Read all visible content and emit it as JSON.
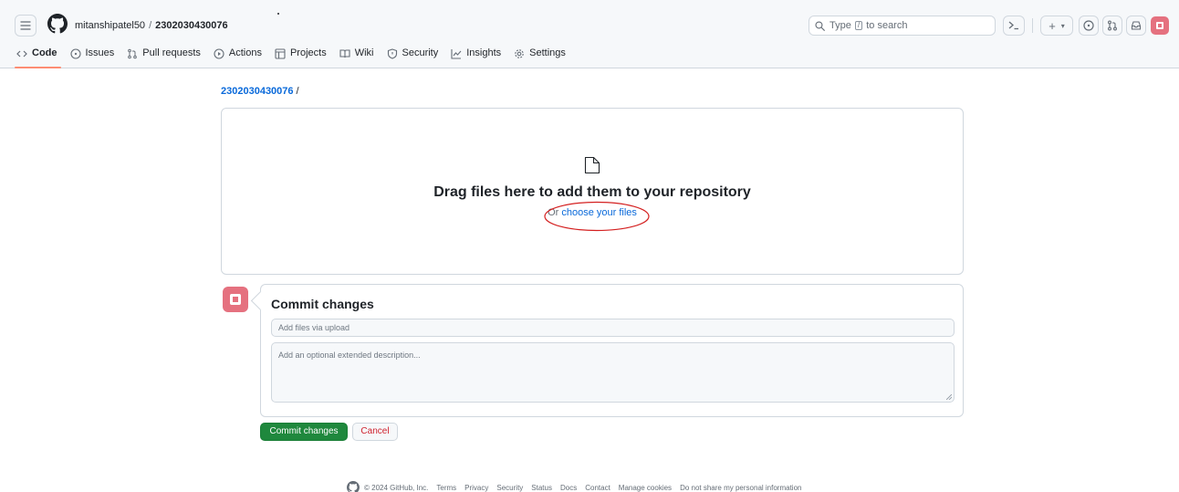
{
  "header": {
    "owner": "mitanshipatel50",
    "separator": "/",
    "repo": "2302030430076",
    "search": {
      "prefix": "Type",
      "key": "/",
      "suffix": "to search"
    },
    "create_label": "+",
    "create_caret": "▾"
  },
  "tabs": [
    {
      "label": "Code",
      "icon": "code-icon"
    },
    {
      "label": "Issues",
      "icon": "issue-icon"
    },
    {
      "label": "Pull requests",
      "icon": "pull-request-icon"
    },
    {
      "label": "Actions",
      "icon": "play-icon"
    },
    {
      "label": "Projects",
      "icon": "table-icon"
    },
    {
      "label": "Wiki",
      "icon": "book-icon"
    },
    {
      "label": "Security",
      "icon": "shield-icon"
    },
    {
      "label": "Insights",
      "icon": "graph-icon"
    },
    {
      "label": "Settings",
      "icon": "gear-icon"
    }
  ],
  "breadcrumb": {
    "repo": "2302030430076",
    "separator": "/"
  },
  "dropzone": {
    "title": "Drag files here to add them to your repository",
    "or_text": "Or",
    "choose_link": "choose your files"
  },
  "commit": {
    "title": "Commit changes",
    "summary_placeholder": "Add files via upload",
    "description_placeholder": "Add an optional extended description...",
    "commit_button": "Commit changes",
    "cancel_button": "Cancel"
  },
  "footer": {
    "copyright": "© 2024 GitHub, Inc.",
    "links": [
      "Terms",
      "Privacy",
      "Security",
      "Status",
      "Docs",
      "Contact",
      "Manage cookies",
      "Do not share my personal information"
    ]
  },
  "colors": {
    "accent_link": "#0969da",
    "commit_green": "#1f883d",
    "cancel_red": "#cf222e",
    "active_tab_underline": "#fd8c73",
    "avatar_pink": "#e5717f",
    "annotation_oval": "#d42020"
  }
}
